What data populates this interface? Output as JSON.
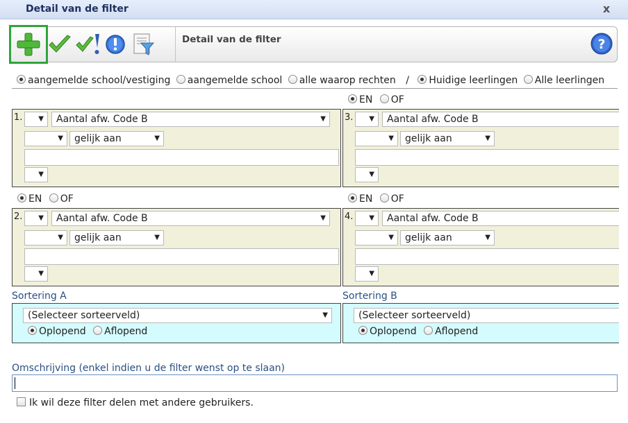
{
  "window": {
    "title": "Detail van de filter",
    "close": "x"
  },
  "toolbar": {
    "title": "Detail van de filter"
  },
  "scope": {
    "options": [
      "aangemelde school/vestiging",
      "aangemelde school",
      "alle waarop rechten"
    ],
    "separator": "/",
    "pupils": [
      "Huidige leerlingen",
      "Alle leerlingen"
    ]
  },
  "logic": {
    "and": "EN",
    "or": "OF"
  },
  "conditions": [
    {
      "num": "1.",
      "field": "Aantal afw. Code B",
      "operator": "gelijk aan",
      "value": ""
    },
    {
      "num": "2.",
      "field": "Aantal afw. Code B",
      "operator": "gelijk aan",
      "value": ""
    },
    {
      "num": "3.",
      "field": "Aantal afw. Code B",
      "operator": "gelijk aan",
      "value": ""
    },
    {
      "num": "4.",
      "field": "Aantal afw. Code B",
      "operator": "gelijk aan",
      "value": ""
    }
  ],
  "sorting": {
    "a": {
      "label": "Sortering A",
      "placeholder": "(Selecteer sorteerveld)",
      "asc": "Oplopend",
      "desc": "Aflopend"
    },
    "b": {
      "label": "Sortering B",
      "placeholder": "(Selecteer sorteerveld)",
      "asc": "Oplopend",
      "desc": "Aflopend"
    }
  },
  "description": {
    "label": "Omschrijving (enkel indien u de filter wenst op te slaan)",
    "value": ""
  },
  "share": {
    "label": "Ik wil deze filter delen met andere gebruikers."
  },
  "icons": {
    "add": "plus-icon",
    "save": "check-icon",
    "save_check": "check-exclamation-icon",
    "info": "info-icon",
    "report": "filter-document-icon",
    "help": "help-icon"
  },
  "colors": {
    "condition_bg": "#f1f0da",
    "sort_bg": "#d4fbfd",
    "add_frame": "#2fa53a",
    "label_blue": "#2a4f83"
  }
}
